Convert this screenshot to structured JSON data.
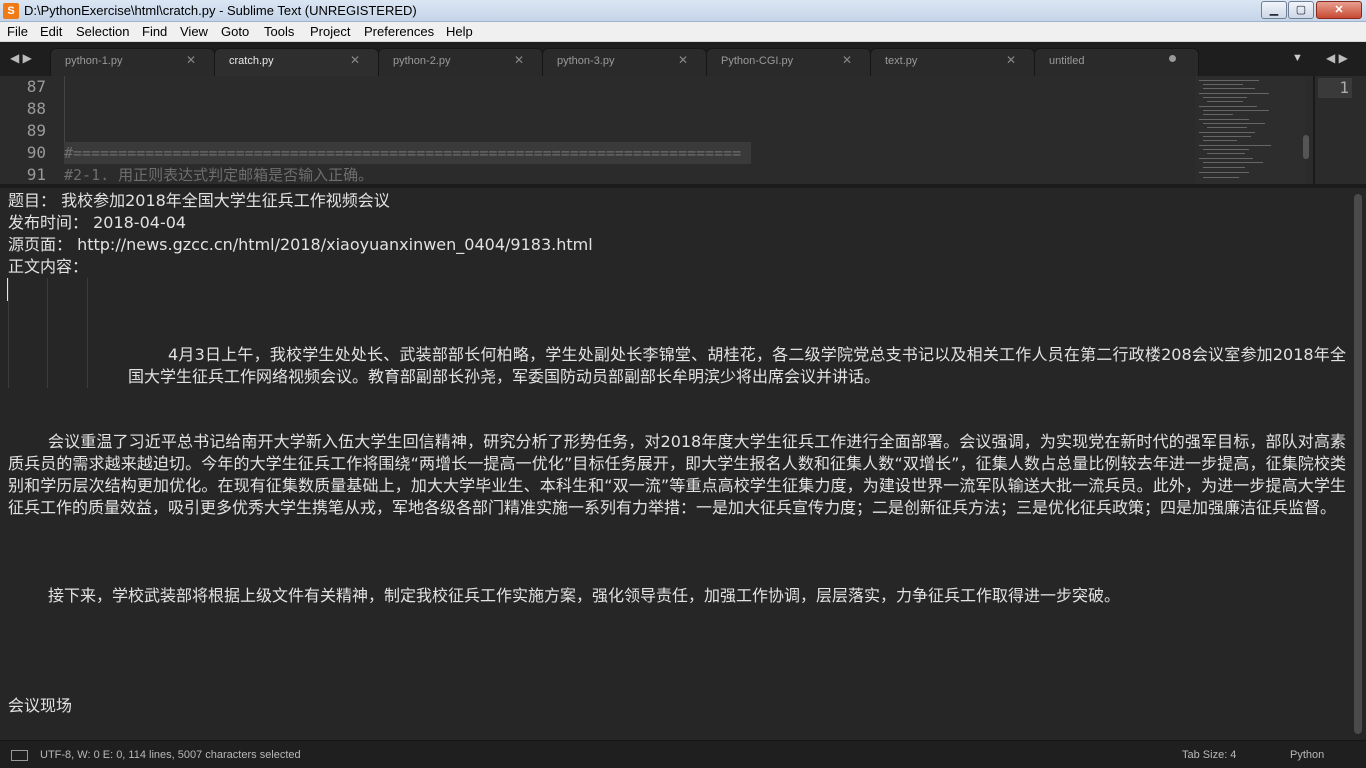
{
  "window": {
    "title": "D:\\PythonExercise\\html\\cratch.py - Sublime Text (UNREGISTERED)",
    "app_icon_glyph": "S",
    "app_icon_color": "#f07a16",
    "controls": {
      "minimize": "▁",
      "maximize": "▢",
      "close": "✕"
    }
  },
  "menu": [
    "File",
    "Edit",
    "Selection",
    "Find",
    "View",
    "Goto",
    "Tools",
    "Project",
    "Preferences",
    "Help"
  ],
  "tabs": [
    {
      "label": "python-1.py",
      "state": "close"
    },
    {
      "label": "cratch.py",
      "state": "close",
      "active": true
    },
    {
      "label": "python-2.py",
      "state": "close"
    },
    {
      "label": "python-3.py",
      "state": "close"
    },
    {
      "label": "Python-CGI.py",
      "state": "close"
    },
    {
      "label": "text.py",
      "state": "close"
    },
    {
      "label": "untitled",
      "state": "dirty"
    }
  ],
  "tab_nav": {
    "left": "◀ ▶",
    "right": "◀ ▶",
    "dropdown": "▼",
    "close_glyph": "✕"
  },
  "editor": {
    "line_numbers": [
      "87",
      "88",
      "89",
      "90",
      "91"
    ],
    "lines": [
      "",
      "",
      "",
      "#==========================================================================",
      "#2-1. 用正则表达式判定邮箱是否输入正确。"
    ],
    "right_pane_line": "1"
  },
  "output": {
    "title_line": "题目：  我校参加2018年全国大学生征兵工作视频会议",
    "time_line": "发布时间：  2018-04-04",
    "source_line": "源页面：  http://news.gzcc.cn/html/2018/xiaoyuanxinwen_0404/9183.html",
    "content_label": "正文内容：",
    "para1": "4月3日上午，我校学生处处长、武装部部长何柏略，学生处副处长李锦堂、胡桂花，各二级学院党总支书记以及相关工作人员在第二行政楼208会议室参加2018年全国大学生征兵工作网络视频会议。教育部副部长孙尧，军委国防动员部副部长牟明滨少将出席会议并讲话。",
    "para2": "会议重温了习近平总书记给南开大学新入伍大学生回信精神，研究分析了形势任务，对2018年度大学生征兵工作进行全面部署。会议强调，为实现党在新时代的强军目标，部队对高素质兵员的需求越来越迫切。今年的大学生征兵工作将围绕“两增长一提高一优化”目标任务展开，即大学生报名人数和征集人数“双增长”，征集人数占总量比例较去年进一步提高，征集院校类别和学历层次结构更加优化。在现有征集数质量基础上，加大大学毕业生、本科生和“双一流”等重点高校学生征集力度，为建设世界一流军队输送大批一流兵员。此外，为进一步提高大学生征兵工作的质量效益，吸引更多优秀大学生携笔从戎，军地各级各部门精准实施一系列有力举措：一是加大征兵宣传力度；二是创新征兵方法；三是优化征兵政策；四是加强廉洁征兵监督。",
    "para3": "接下来，学校武装部将根据上级文件有关精神，制定我校征兵工作实施方案，强化领导责任，加强工作协调，层层落实，力争征兵工作取得进一步突破。",
    "section": "会议现场"
  },
  "status": {
    "left": "UTF-8, W: 0 E: 0, 114 lines, 5007 characters selected",
    "tab_size": "Tab Size: 4",
    "syntax": "Python"
  }
}
